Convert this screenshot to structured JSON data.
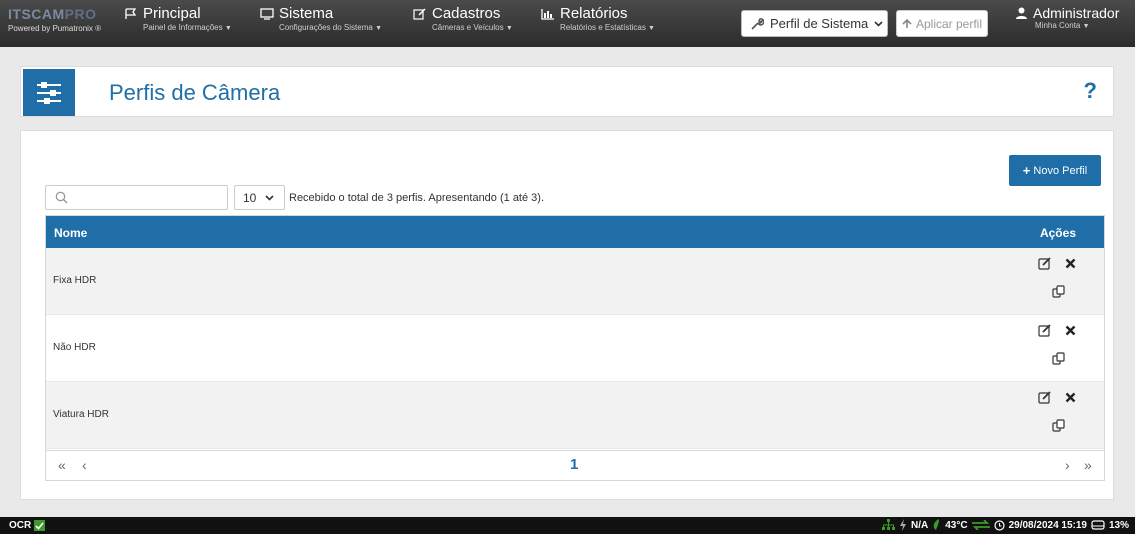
{
  "navbar": {
    "logo_text": "ITSCAM",
    "logo_suffix": "PRO",
    "powered_by": "Powered by Pumatronix ®",
    "items": [
      {
        "label": "Principal",
        "sub": "Painel de Informações",
        "icon": "flag-icon"
      },
      {
        "label": "Sistema",
        "sub": "Configurações do Sistema",
        "icon": "monitor-icon"
      },
      {
        "label": "Cadastros",
        "sub": "Câmeras e Veículos",
        "icon": "edit-icon"
      },
      {
        "label": "Relatórios",
        "sub": "Relatórios e Estatísticas",
        "icon": "bar-chart-icon"
      }
    ],
    "profile_select": "Perfil de Sistema",
    "apply_label": "Aplicar perfil",
    "user": {
      "label": "Administrador",
      "sub": "Minha Conta"
    }
  },
  "page": {
    "title": "Perfis de Câmera",
    "help": "?"
  },
  "toolbar": {
    "new_button": "Novo Perfil",
    "search_placeholder": "",
    "page_size": "10",
    "count_text": "Recebido o total de 3 perfis. Apresentando (1 até 3)."
  },
  "table": {
    "columns": {
      "name": "Nome",
      "actions": "Ações"
    },
    "rows": [
      {
        "name": "Fixa HDR"
      },
      {
        "name": "Não HDR"
      },
      {
        "name": "Viatura HDR"
      }
    ],
    "pagination": {
      "first": "«",
      "prev": "‹",
      "current": "1",
      "next": "›",
      "last": "»"
    }
  },
  "status": {
    "ocr": "OCR",
    "na": "N/A",
    "temp": "43°C",
    "datetime": "29/08/2024 15:19",
    "disk": "13%"
  },
  "colors": {
    "accent": "#1f6ea8",
    "navbar": "#3a3a3a",
    "status_ok": "#3b9a2a"
  }
}
